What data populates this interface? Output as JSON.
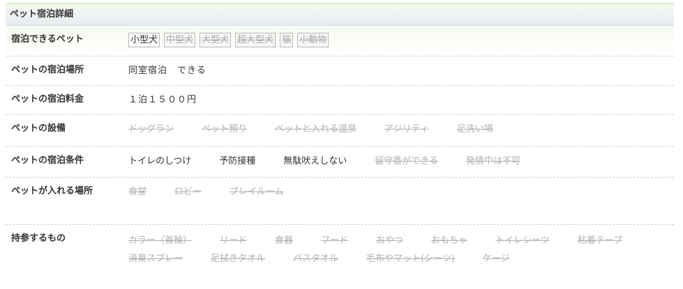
{
  "section_title": "ペット宿泊詳細",
  "rows": {
    "pets": {
      "label": "宿泊できるペット",
      "items": [
        {
          "text": "小型犬",
          "active": true
        },
        {
          "text": "中型犬",
          "active": false
        },
        {
          "text": "大型犬",
          "active": false
        },
        {
          "text": "超大型犬",
          "active": false
        },
        {
          "text": "猫",
          "active": false
        },
        {
          "text": "小動物",
          "active": false
        }
      ]
    },
    "place": {
      "label": "ペットの宿泊場所",
      "value": "同室宿泊　できる"
    },
    "fee": {
      "label": "ペットの宿泊料金",
      "value": "１泊１５００円"
    },
    "facilities": {
      "label": "ペットの設備",
      "items": [
        {
          "text": "ドッグラン",
          "active": false
        },
        {
          "text": "ペット預り",
          "active": false
        },
        {
          "text": "ペットと入れる温泉",
          "active": false
        },
        {
          "text": "アジリティ",
          "active": false
        },
        {
          "text": "足洗い場",
          "active": false
        }
      ]
    },
    "conditions": {
      "label": "ペットの宿泊条件",
      "items": [
        {
          "text": "トイレのしつけ",
          "active": true
        },
        {
          "text": "予防接種",
          "active": true
        },
        {
          "text": "無駄吠えしない",
          "active": true
        },
        {
          "text": "留守番ができる",
          "active": false
        },
        {
          "text": "発情中は不可",
          "active": false
        }
      ]
    },
    "areas": {
      "label": "ペットが入れる場所",
      "items": [
        {
          "text": "食堂",
          "active": false
        },
        {
          "text": "ロビー",
          "active": false
        },
        {
          "text": "プレイルーム",
          "active": false
        }
      ]
    },
    "bring": {
      "label": "持参するもの",
      "items": [
        {
          "text": "カラー（首輪）",
          "active": false
        },
        {
          "text": "リード",
          "active": false
        },
        {
          "text": "食器",
          "active": false
        },
        {
          "text": "フード",
          "active": false
        },
        {
          "text": "おやつ",
          "active": false
        },
        {
          "text": "おもちゃ",
          "active": false
        },
        {
          "text": "トイレシーツ",
          "active": false
        },
        {
          "text": "粘着テープ",
          "active": false
        },
        {
          "text": "消臭スプレー",
          "active": false
        },
        {
          "text": "足拭きタオル",
          "active": false
        },
        {
          "text": "バスタオル",
          "active": false
        },
        {
          "text": "毛布やマット(シーツ)",
          "active": false
        },
        {
          "text": "ケージ",
          "active": false
        }
      ]
    }
  }
}
